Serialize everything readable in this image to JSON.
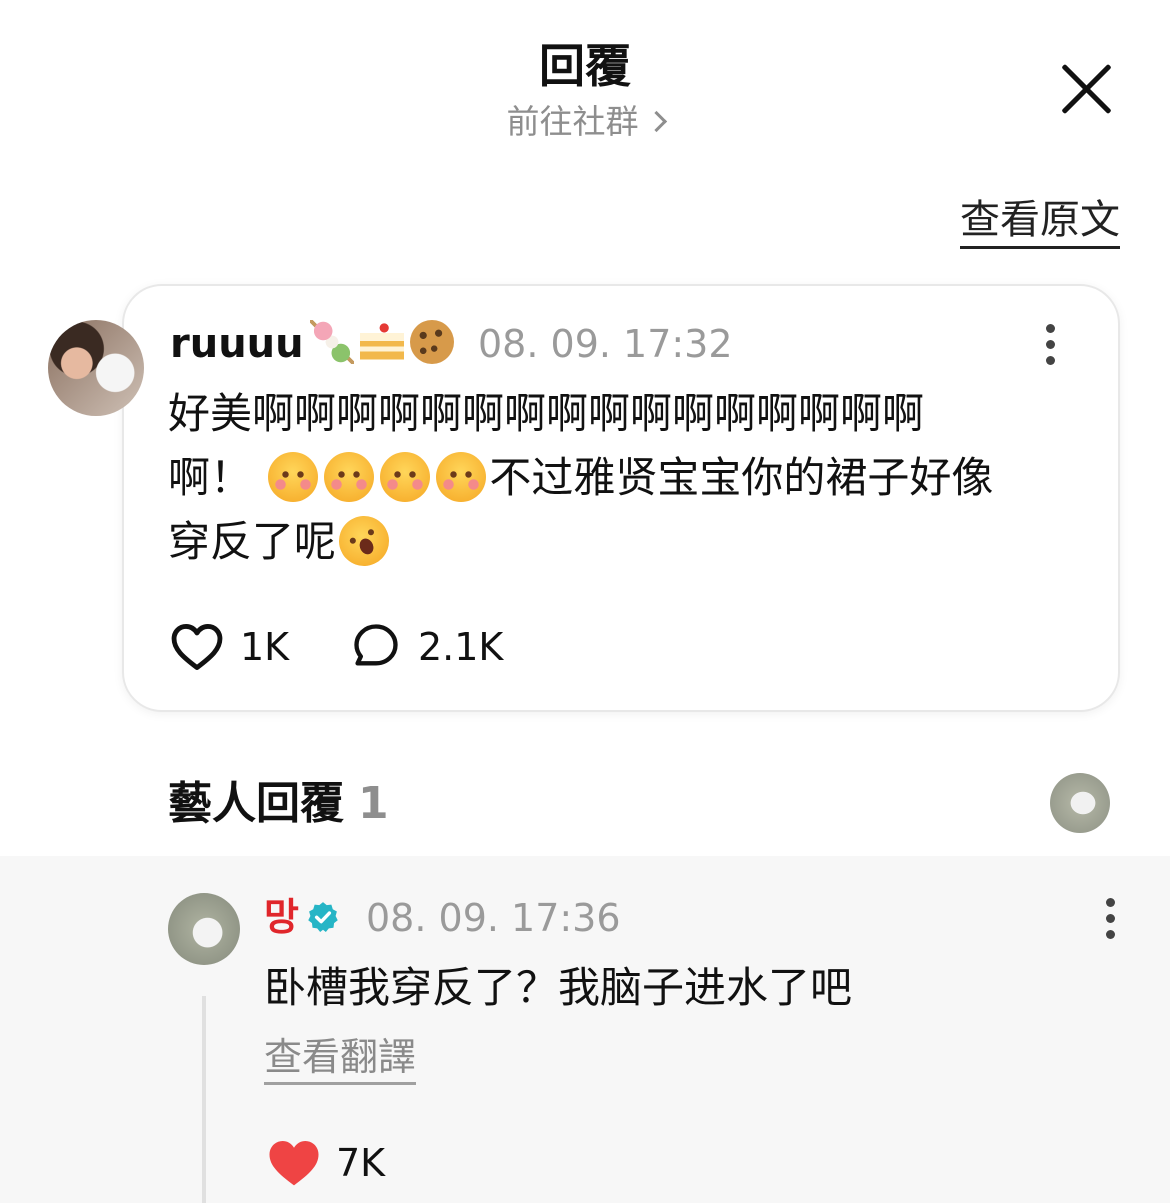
{
  "header": {
    "title": "回覆",
    "subtitle": "前往社群",
    "view_original": "查看原文"
  },
  "comment": {
    "username": "ruuuu",
    "name_emojis": [
      "dango-icon",
      "cake-icon",
      "cookie-icon"
    ],
    "timestamp": "08. 09. 17:32",
    "text_line1": "好美啊啊啊啊啊啊啊啊啊啊啊啊啊啊啊啊",
    "text_line2_start": "啊！",
    "text_line2_end": "不过雅贤宝宝你的裙子好像",
    "text_line3": "穿反了呢",
    "likes": "1K",
    "replies": "2.1K"
  },
  "artist_section": {
    "title": "藝人回覆",
    "count": "1"
  },
  "reply": {
    "username": "망",
    "timestamp": "08. 09. 17:36",
    "text": "卧槽我穿反了？我脑子进水了吧",
    "translate_label": "查看翻譯",
    "likes": "7K"
  },
  "colors": {
    "accent_red": "#e0262b",
    "verified_teal": "#26b5c6",
    "heart_red": "#ef4444",
    "muted_text": "#8e8e8e"
  }
}
